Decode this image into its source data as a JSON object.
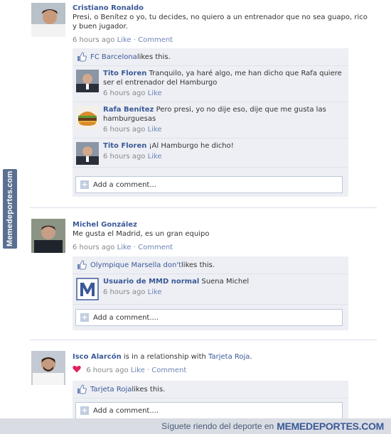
{
  "watermark": {
    "side": "Memedeportes.com",
    "footer_tagline": "Síguete riendo del deporte en",
    "footer_brand": "MEMEDEPORTES.COM"
  },
  "posts": [
    {
      "author": "Cristiano Ronaldo",
      "text": "Presi, o Benítez o yo, tu decides, no quiero a un entrenador que no sea guapo, rico y buen jugador.",
      "time": "6 hours ago",
      "like": "Like",
      "comment": "Comment",
      "likes": {
        "who": "FC Barcelona",
        "suffix": " likes this."
      },
      "comments": [
        {
          "author": "Tito Floren",
          "text": "Tranquilo, ya haré algo, me han dicho que Rafa quiere ser el entrenador del Hamburgo",
          "time": "6 hours ago",
          "like": "Like"
        },
        {
          "author": "Rafa Benítez",
          "text": "Pero presi, yo no dije eso, dije que me gusta las hamburguesas",
          "time": "6 hours ago",
          "like": "Like"
        },
        {
          "author": "Tito Floren",
          "text": "¡Al Hamburgo he dicho!",
          "time": "6 hours ago",
          "like": "Like"
        }
      ],
      "add_comment": "Add a comment..."
    },
    {
      "author": "Michel González",
      "text": "Me gusta el Madrid, es un gran equipo",
      "time": "6 hours ago",
      "like": "Like",
      "comment": "Comment",
      "likes": {
        "who": "Olympique Marsella don't",
        "suffix": " likes this."
      },
      "comments": [
        {
          "author": "Usuario de MMD normal",
          "text": "Suena Michel",
          "time": "6 hours ago",
          "like": "Like"
        }
      ],
      "add_comment": "Add a comment...."
    },
    {
      "author": "Isco Alarcón",
      "rel_text": " is in a relationship with ",
      "rel_target": "Tarjeta Roja",
      "rel_end": ".",
      "time": "6 hours ago",
      "like": "Like",
      "comment": "Comment",
      "likes": {
        "who": "Tarjeta Roja",
        "suffix": " likes this."
      },
      "add_comment": "Add a comment...."
    }
  ],
  "colors": {
    "link": "#3b5998",
    "meta": "#888888",
    "comment_bg": "#edeff4",
    "heart": "#e0245e"
  },
  "icons": [
    "thumbs-up-icon",
    "plus-icon",
    "heart-icon"
  ]
}
